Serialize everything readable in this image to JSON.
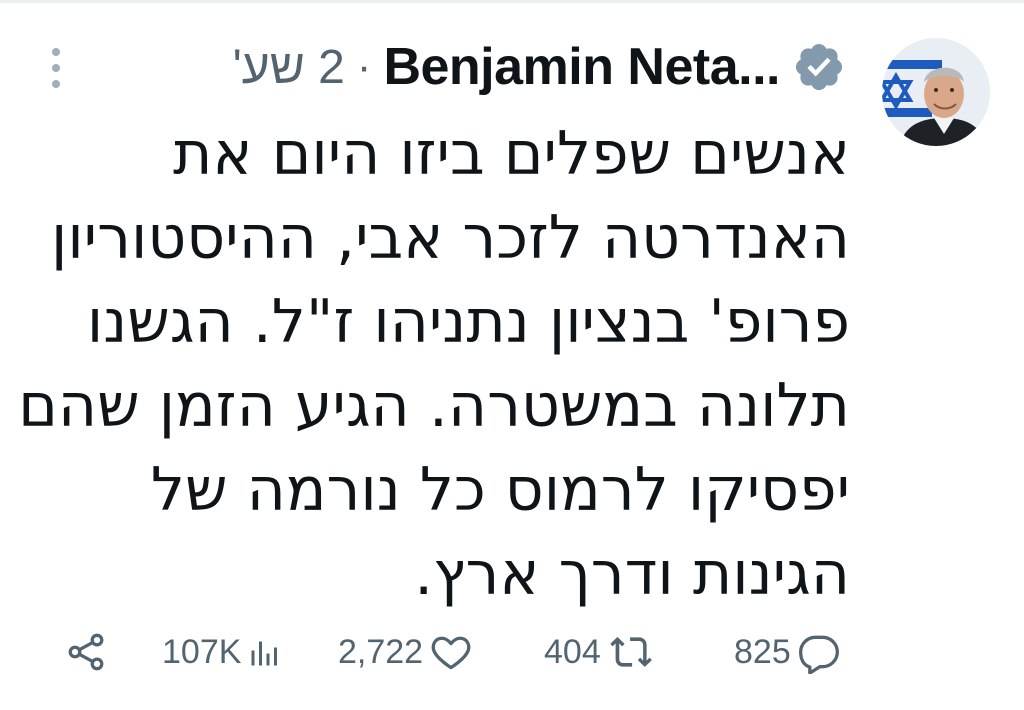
{
  "tweet": {
    "author": {
      "name": "Benjamin Neta...",
      "verified": true,
      "avatar": "profile-photo"
    },
    "separator": "·",
    "timestamp": "2 שע'",
    "text_lines": [
      "אנשים שפלים ביזו היום את",
      "האנדרטה לזכר אבי, ההיסטוריון",
      "פרופ' בנציון נתניהו ז\"ל. הגשנו",
      "תלונה במשטרה. הגיע הזמן שהם",
      "יפסיקו לרמוס כל נורמה של",
      "הגינות ודרך ארץ."
    ],
    "actions": {
      "share_icon": "share-icon",
      "views": "107K",
      "views_icon": "views-icon",
      "likes": "2,722",
      "likes_icon": "heart-icon",
      "reposts": "404",
      "reposts_icon": "repost-icon",
      "replies": "825",
      "replies_icon": "reply-icon"
    }
  },
  "colors": {
    "text": "#0f1419",
    "muted": "#536471",
    "verified_badge": "#829aab",
    "background": "#ffffff"
  }
}
